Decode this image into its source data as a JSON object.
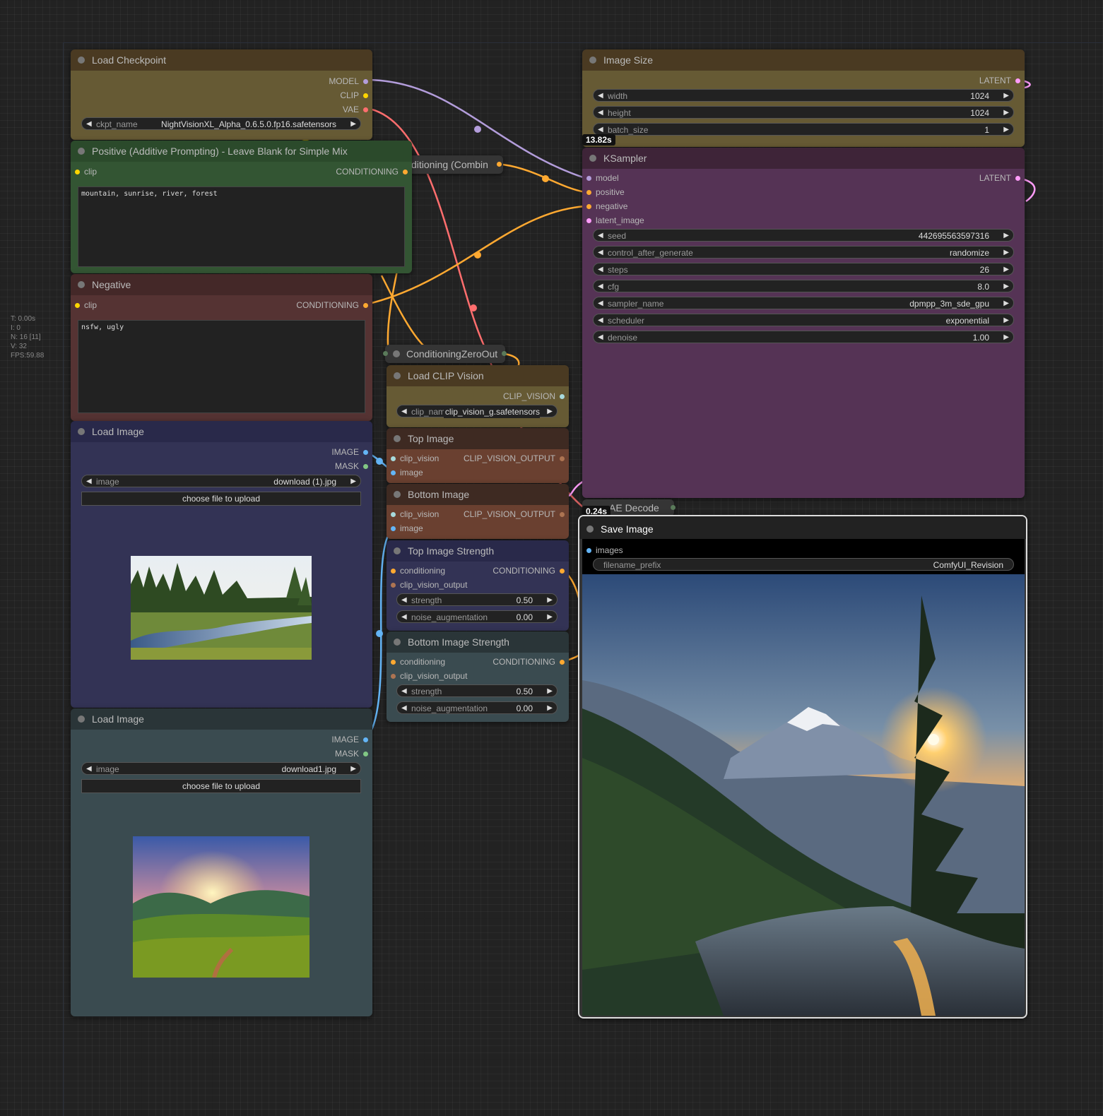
{
  "stats": {
    "t": "T: 0.00s",
    "i": "I: 0",
    "n": "N: 16 [11]",
    "v": "V: 32",
    "fps": "FPS:59.88"
  },
  "load_checkpoint": {
    "title": "Load Checkpoint",
    "outputs": [
      "MODEL",
      "CLIP",
      "VAE"
    ],
    "ckpt_label": "ckpt_name",
    "ckpt_value": "NightVisionXL_Alpha_0.6.5.0.fp16.safetensors"
  },
  "positive": {
    "title": "Positive (Additive Prompting) - Leave Blank for Simple Mix",
    "input": "clip",
    "output": "CONDITIONING",
    "text": "mountain, sunrise, river, forest"
  },
  "negative": {
    "title": "Negative",
    "input": "clip",
    "output": "CONDITIONING",
    "text": "nsfw, ugly"
  },
  "conditioning_combine": {
    "title": "ditioning (Combin"
  },
  "conditioning_zero": {
    "title": "ConditioningZeroOut"
  },
  "load_image_1": {
    "title": "Load Image",
    "outputs": [
      "IMAGE",
      "MASK"
    ],
    "image_label": "image",
    "image_value": "download (1).jpg",
    "upload": "choose file to upload"
  },
  "load_image_2": {
    "title": "Load Image",
    "outputs": [
      "IMAGE",
      "MASK"
    ],
    "image_label": "image",
    "image_value": "download1.jpg",
    "upload": "choose file to upload"
  },
  "load_clip_vision": {
    "title": "Load CLIP Vision",
    "output": "CLIP_VISION",
    "label": "clip_name",
    "value": "clip_vision_g.safetensors"
  },
  "top_image": {
    "title": "Top Image",
    "inputs": [
      "clip_vision",
      "image"
    ],
    "output": "CLIP_VISION_OUTPUT"
  },
  "bottom_image": {
    "title": "Bottom Image",
    "inputs": [
      "clip_vision",
      "image"
    ],
    "output": "CLIP_VISION_OUTPUT"
  },
  "top_strength": {
    "title": "Top Image Strength",
    "inputs": [
      "conditioning",
      "clip_vision_output"
    ],
    "output": "CONDITIONING",
    "strength_label": "strength",
    "strength": "0.50",
    "noise_label": "noise_augmentation",
    "noise": "0.00"
  },
  "bottom_strength": {
    "title": "Bottom Image Strength",
    "inputs": [
      "conditioning",
      "clip_vision_output"
    ],
    "output": "CONDITIONING",
    "strength_label": "strength",
    "strength": "0.50",
    "noise_label": "noise_augmentation",
    "noise": "0.00"
  },
  "image_size": {
    "title": "Image Size",
    "output": "LATENT",
    "widgets": [
      {
        "label": "width",
        "value": "1024"
      },
      {
        "label": "height",
        "value": "1024"
      },
      {
        "label": "batch_size",
        "value": "1"
      }
    ],
    "timing": "13.82s"
  },
  "ksampler": {
    "title": "KSampler",
    "inputs": [
      "model",
      "positive",
      "negative",
      "latent_image"
    ],
    "output": "LATENT",
    "widgets": [
      {
        "label": "seed",
        "value": "442695563597316"
      },
      {
        "label": "control_after_generate",
        "value": "randomize"
      },
      {
        "label": "steps",
        "value": "26"
      },
      {
        "label": "cfg",
        "value": "8.0"
      },
      {
        "label": "sampler_name",
        "value": "dpmpp_3m_sde_gpu"
      },
      {
        "label": "scheduler",
        "value": "exponential"
      },
      {
        "label": "denoise",
        "value": "1.00"
      }
    ]
  },
  "vae_decode": {
    "title": "AE Decode",
    "timing": "0.24s"
  },
  "save_image": {
    "title": "Save Image",
    "input": "images",
    "prefix_label": "filename_prefix",
    "prefix_value": "ComfyUI_Revision"
  },
  "colors": {
    "model": "#b39ddb",
    "clip": "#ffd500",
    "vae": "#ff6e6e",
    "conditioning": "#ffa931",
    "image": "#64b5f6",
    "mask": "#81c784",
    "latent": "#ff9cf9",
    "clip_vision": "#a8dadc",
    "clip_vision_output": "#ad7452"
  }
}
